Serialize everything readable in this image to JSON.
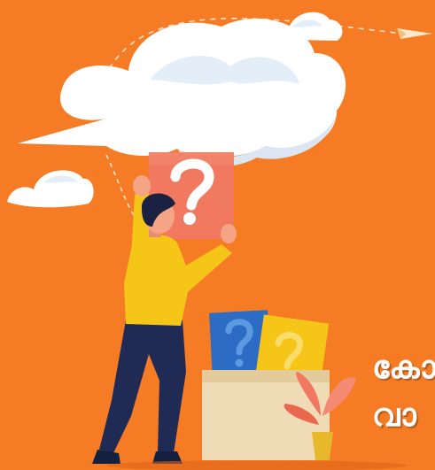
{
  "illustration": {
    "subject": "person-holding-question-puzzle-piece",
    "icons": [
      "cloud-icon",
      "paper-plane-icon",
      "question-mark-icon",
      "box-icon",
      "plant-icon"
    ]
  },
  "caption": {
    "line1": "കോ",
    "line2": "വാ"
  },
  "colors": {
    "background": "#f57c25",
    "cloud": "#ffffff",
    "puzzle": "#f0795f",
    "shirt": "#f5c518",
    "pants": "#1f2a55",
    "card_blue": "#2c6cc4",
    "card_yellow": "#f5c518",
    "box": "#efdcb6"
  }
}
